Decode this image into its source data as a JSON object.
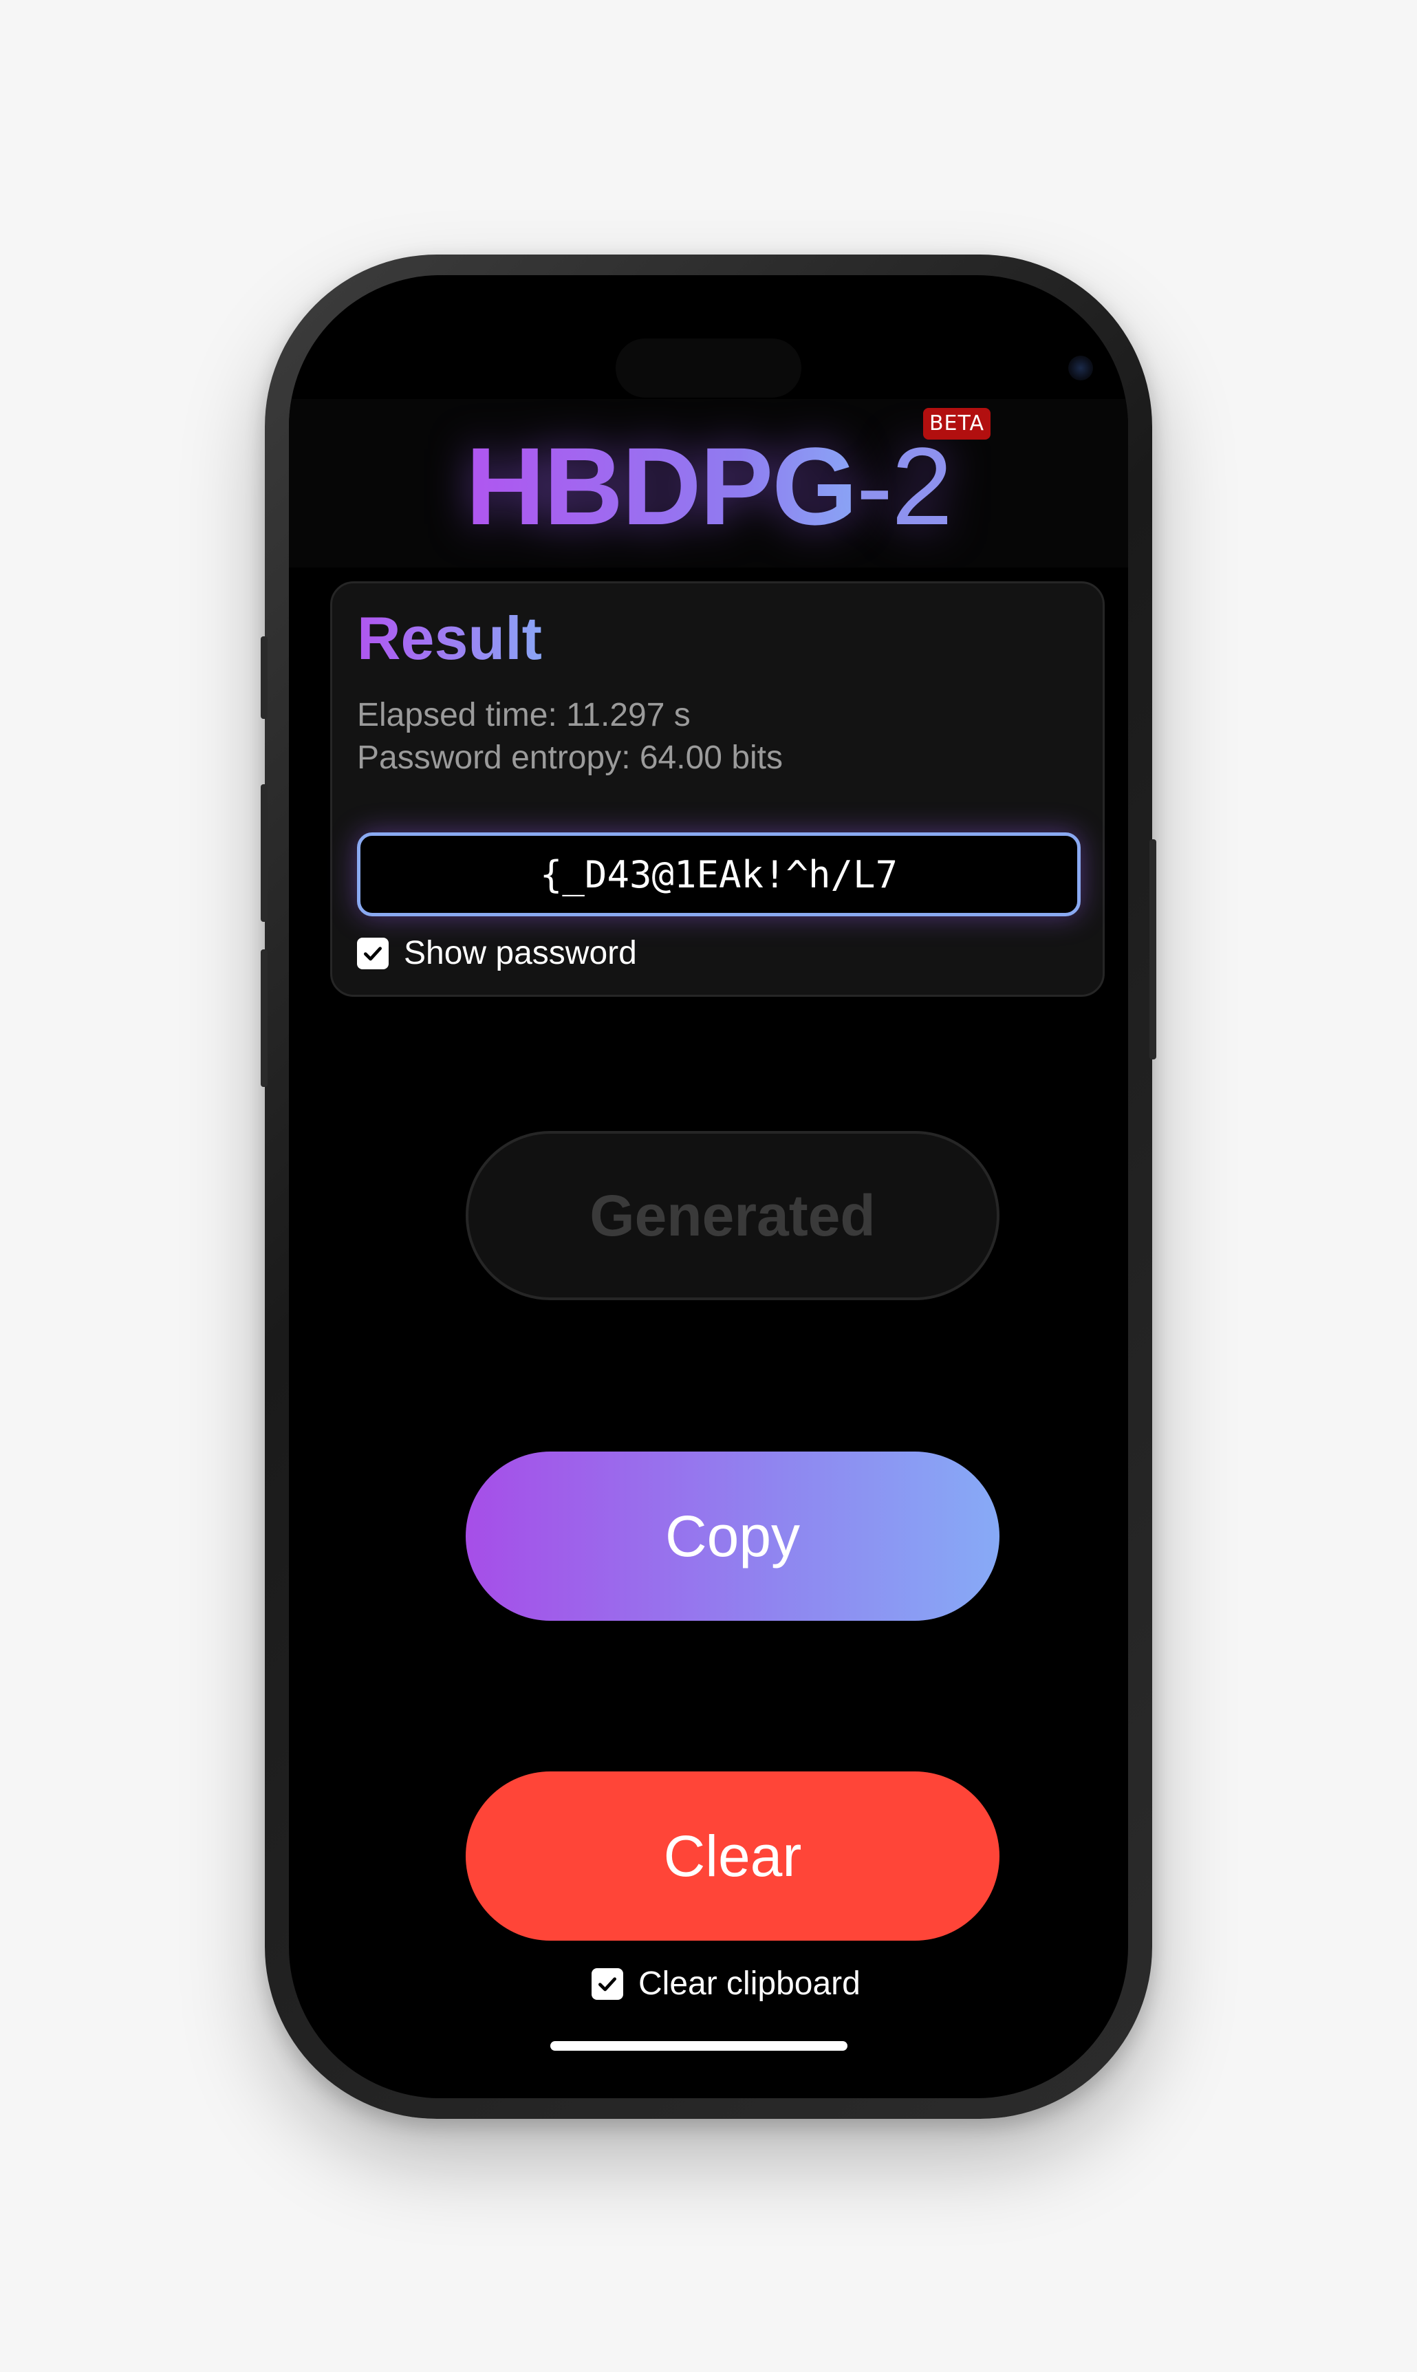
{
  "app": {
    "logo_main": "HBDPG",
    "logo_suffix": "-2",
    "badge": "BETA"
  },
  "result": {
    "title": "Result",
    "elapsed": "Elapsed time: 11.297 s",
    "entropy": "Password entropy: 64.00 bits",
    "password": "{_D43@1EAk!^h/L7",
    "show_password_label": "Show password",
    "show_password_checked": true
  },
  "buttons": {
    "generated_label": "Generated",
    "copy_label": "Copy",
    "clear_label": "Clear"
  },
  "clear_clipboard": {
    "label": "Clear clipboard",
    "checked": true
  },
  "colors": {
    "accent_purple": "#b056f0",
    "accent_blue": "#8aa6f5",
    "clear_red": "#ff4538",
    "badge_red": "#b20f0f"
  },
  "icons": {
    "checkbox": "checkmark-icon"
  }
}
